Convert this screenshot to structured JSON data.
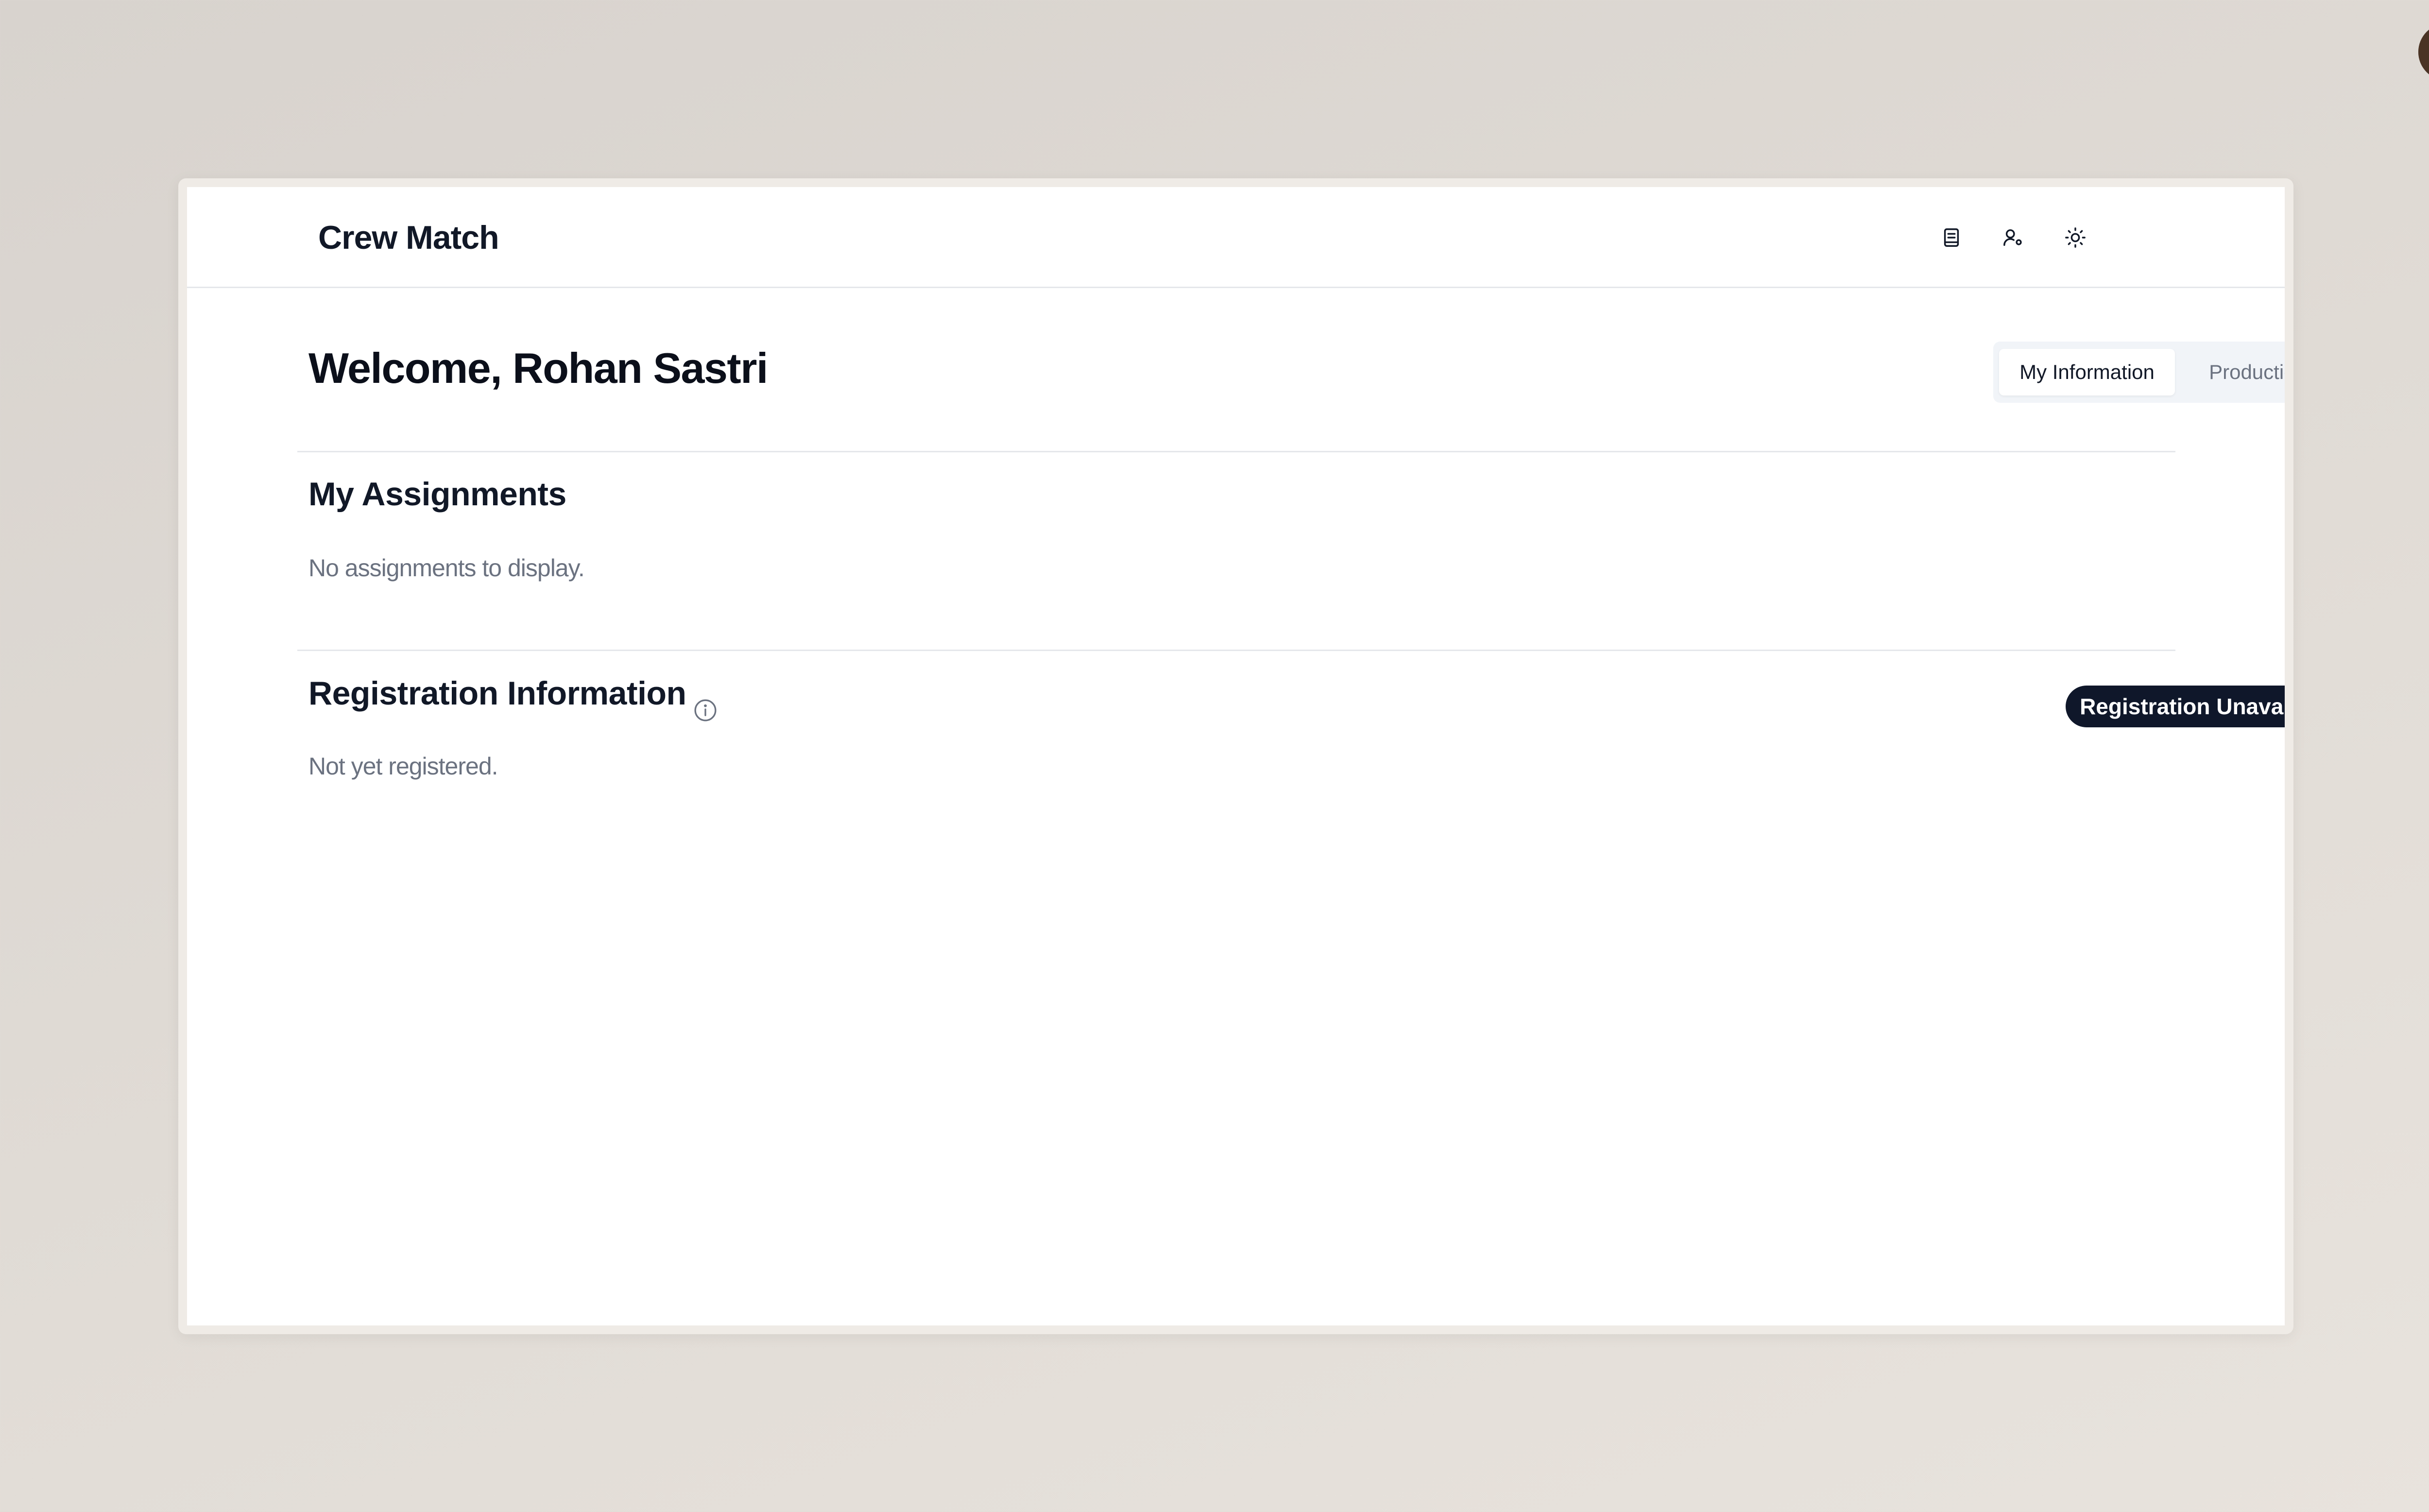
{
  "app": {
    "brand": "Crew Match"
  },
  "header": {
    "icons": [
      "document-icon",
      "user-settings-icon",
      "sun-icon"
    ],
    "avatar_alt": "user avatar"
  },
  "main": {
    "welcome": "Welcome, Rohan Sastri",
    "tabs": [
      {
        "label": "My Information",
        "active": true
      },
      {
        "label": "Productions",
        "active": false
      }
    ]
  },
  "assignments": {
    "title": "My Assignments",
    "empty_text": "No assignments to display."
  },
  "registration": {
    "title": "Registration Information",
    "status_badge": "Registration Unavailable",
    "body_text": "Not yet registered."
  },
  "colors": {
    "badge_bg": "#0f172a",
    "muted_text": "#6b7280",
    "tab_bg": "#f1f4f8"
  }
}
